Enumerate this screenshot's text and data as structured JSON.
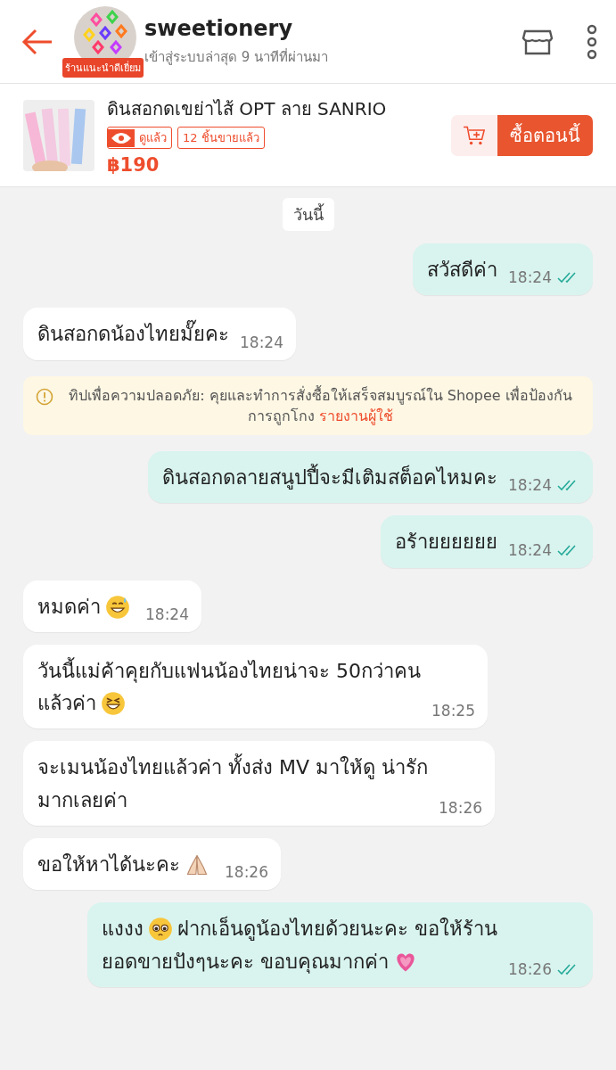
{
  "header": {
    "shop_name": "sweetionery",
    "badge": "ร้านแนะนำดีเยี่ยม",
    "last_seen": "เข้าสู่ระบบล่าสุด 9 นาทีที่ผ่านมา"
  },
  "product": {
    "title": "ดินสอกดเขย่าไส้ OPT ลาย SANRIO",
    "viewed": "ดูแล้ว",
    "sold": "12 ชิ้นขายแล้ว",
    "price": "฿190",
    "buy_button": "ซื้อตอนนี้"
  },
  "date_label": "วันนี้",
  "messages": [
    {
      "kind": "sent",
      "lines": [
        [
          {
            "kind": "text",
            "text": "สวัสดีค่า"
          }
        ]
      ],
      "time": "18:24",
      "read": true
    },
    {
      "kind": "received",
      "lines": [
        [
          {
            "kind": "text",
            "text": "ดินสอกดน้องไทยมั๊ยคะ"
          }
        ]
      ],
      "time": "18:24"
    },
    {
      "kind": "notice",
      "text": "ทิปเพื่อความปลอดภัย: คุยและทำการสั่งซื้อให้เสร็จสมบูรณ์ใน Shopee เพื่อป้องกันการถูกโกง",
      "link": "รายงานผู้ใช้"
    },
    {
      "kind": "sent",
      "lines": [
        [
          {
            "kind": "text",
            "text": "ดินสอกดลายสนูปปี้จะมีเติมสต็อคไหมคะ"
          }
        ]
      ],
      "time": "18:24",
      "read": true
    },
    {
      "kind": "sent",
      "lines": [
        [
          {
            "kind": "text",
            "text": "อร้ายยยยยย"
          }
        ]
      ],
      "time": "18:24",
      "read": true
    },
    {
      "kind": "received",
      "lines": [
        [
          {
            "kind": "text",
            "text": "หมดค่า"
          },
          {
            "kind": "sweat"
          }
        ]
      ],
      "time": "18:24"
    },
    {
      "kind": "received",
      "lines": [
        [
          {
            "kind": "text",
            "text": "วันนี้แม่ค้าคุยกับแฟนน้องไทยน่าจะ 50กว่าคน"
          }
        ],
        [
          {
            "kind": "text",
            "text": "แล้วค่า"
          },
          {
            "kind": "laugh"
          }
        ]
      ],
      "time": "18:25"
    },
    {
      "kind": "received",
      "lines": [
        [
          {
            "kind": "text",
            "text": "จะเมนน้องไทยแล้วค่า ทั้งส่ง MV มาให้ดู น่ารัก"
          }
        ],
        [
          {
            "kind": "text",
            "text": "มากเลยค่า"
          }
        ]
      ],
      "time": "18:26"
    },
    {
      "kind": "received",
      "lines": [
        [
          {
            "kind": "text",
            "text": "ขอให้หาได้นะคะ"
          },
          {
            "kind": "pray"
          }
        ]
      ],
      "time": "18:26"
    },
    {
      "kind": "sent",
      "lines": [
        [
          {
            "kind": "text",
            "text": "แงงง"
          },
          {
            "kind": "pleading"
          },
          {
            "kind": "text",
            "text": "ฝากเอ็นดูน้องไทยด้วยนะคะ ขอให้ร้าน"
          }
        ],
        [
          {
            "kind": "text",
            "text": "ยอดขายปังๆนะคะ ขอบคุณมากค่า"
          },
          {
            "kind": "heart"
          }
        ]
      ],
      "time": "18:26",
      "read": true
    }
  ]
}
